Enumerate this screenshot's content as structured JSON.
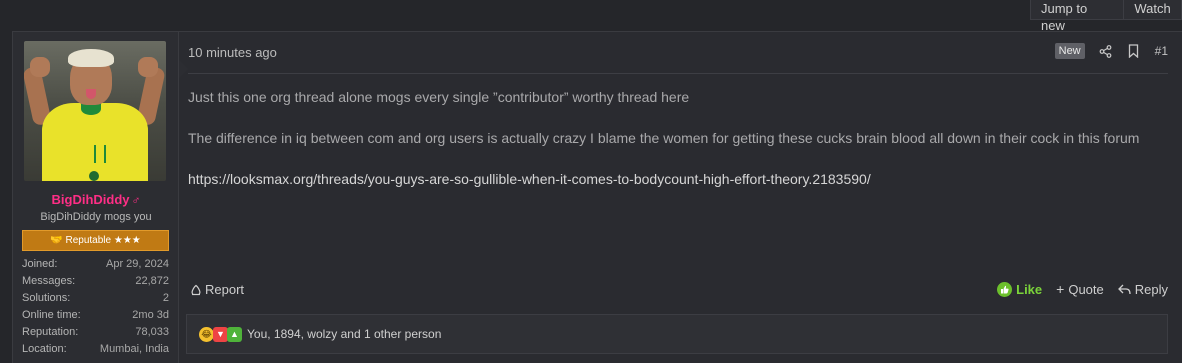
{
  "top_buttons": {
    "jump": "Jump to new",
    "watch": "Watch"
  },
  "user": {
    "username": "BigDihDiddy",
    "gender_symbol": "♂",
    "user_title": "BigDihDiddy mogs you",
    "banner": "🤝 Reputable ★★★",
    "stats": [
      {
        "key": "Joined:",
        "value": "Apr 29, 2024"
      },
      {
        "key": "Messages:",
        "value": "22,872"
      },
      {
        "key": "Solutions:",
        "value": "2"
      },
      {
        "key": "Online time:",
        "value": "2mo 3d"
      },
      {
        "key": "Reputation:",
        "value": "78,033"
      },
      {
        "key": "Location:",
        "value": "Mumbai, India"
      }
    ],
    "username_color": "#ff2e86",
    "banner_color": "#c07a14"
  },
  "post": {
    "time": "10 minutes ago",
    "new_badge": "New",
    "number": "#1",
    "paragraph1": "Just this one org thread alone mogs every single ”contributor” worthy thread here",
    "paragraph2": "The difference in iq between com and org users is actually crazy I blame the women for getting these cucks brain blood all down in their cock in this forum",
    "link": "https://looksmax.org/threads/you-guys-are-so-gullible-when-it-comes-to-bodycount-high-effort-theory.2183590/"
  },
  "actions": {
    "report": "Report",
    "like": "Like",
    "quote": "Quote",
    "reply": "Reply",
    "like_color": "#7bd33a"
  },
  "reactions": {
    "text": "You, 1894, wolzy and 1 other person",
    "icons": [
      "laugh-icon",
      "thumbs-down-icon",
      "thumbs-up-icon"
    ]
  },
  "icons": [
    "share-icon",
    "bookmark-icon",
    "report-icon",
    "like-icon",
    "quote-icon",
    "reply-icon"
  ]
}
